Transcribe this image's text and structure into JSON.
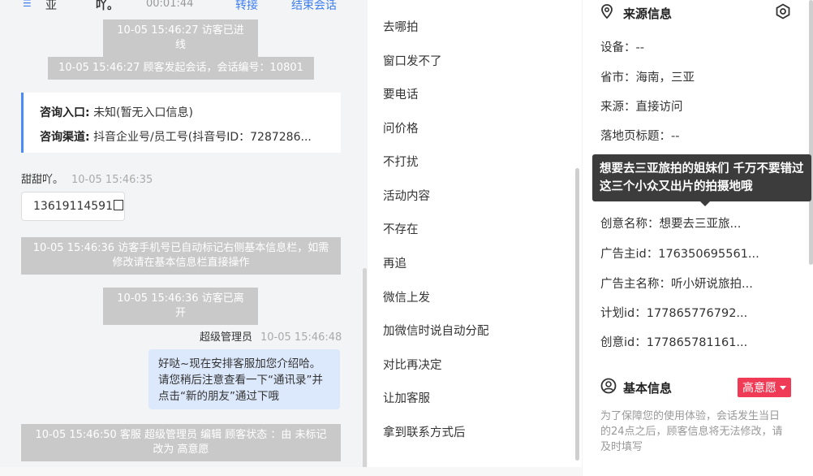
{
  "header": {
    "frag1": "亚",
    "frag2": "吖。",
    "timer": "00:01:44",
    "transfer_label": "转接",
    "end_label": "结束会话",
    "accent": "#3d7ef0"
  },
  "chat": {
    "sys1": "10-05 15:46:27 访客已进线",
    "sys2": "10-05 15:46:27 顾客发起会话，会话编号：10801",
    "info_entry_key": "咨询入口:",
    "info_entry_val": "未知(暂无入口信息)",
    "info_channel_key": "咨询渠道:",
    "info_channel_val": "抖音企业号/员工号(抖音号ID：7287286...",
    "visitor_name": "甜甜吖。",
    "visitor_time": "10-05 15:46:35",
    "visitor_phone": "13619114591",
    "sys3": "10-05 15:46:36 访客手机号已自动标记右侧基本信息栏，如需修改请在基本信息栏直接操作",
    "sys4": "10-05 15:46:36 访客已离开",
    "agent_name": "超级管理员",
    "agent_time": "10-05 15:46:48",
    "agent_msg": "好哒~现在安排客服加您介绍哈。请您稍后注意查看一下“通讯录”并点击“新的朋友”通过下哦",
    "sys5": "10-05 15:46:50 客服 超级管理员 编辑 顾客状态 ：由 未标记 改为 高意愿"
  },
  "quick_replies": [
    "去哪拍",
    "窗口发不了",
    "要电话",
    "问价格",
    "不打扰",
    "活动内容",
    "不存在",
    "再追",
    "微信上发",
    "加微信时说自动分配",
    "对比再决定",
    "让加客服",
    "拿到联系方式后"
  ],
  "source_info": {
    "title": "来源信息",
    "device": "设备：--",
    "province": "省市：海南，三亚",
    "source": "来源：直接访问",
    "landing_title": "落地页标题：--",
    "creative_name": "创意名称：想要去三亚旅...",
    "advertiser_id": "广告主id：176350695561...",
    "advertiser_name": "广告主名称：听小妍说旅拍...",
    "plan_id": "计划id：177865776792...",
    "creative_id": "创意id：177865781161...",
    "tooltip": "想要去三亚旅拍的姐妹们 千万不要错过这三个小众又出片的拍摄地哦"
  },
  "basic_info": {
    "title": "基本信息",
    "intent_tag": "高意愿",
    "tag_color": "#ef3b56",
    "note": "为了保障您的使用体验，会话发生当日的24点之后，顾客信息将无法修改，请及时填写"
  }
}
